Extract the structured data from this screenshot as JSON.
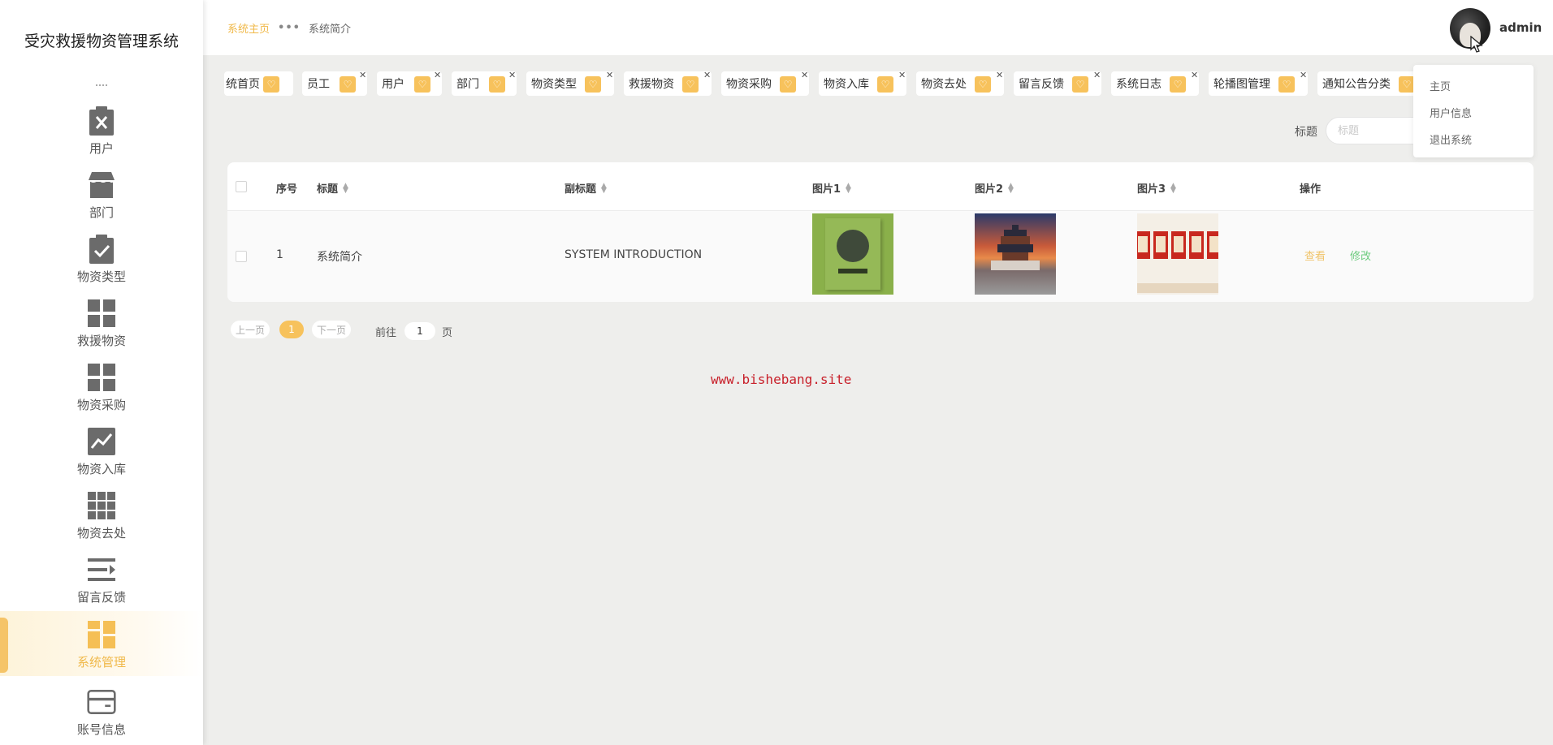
{
  "app": {
    "title": "受灾救援物资管理系统"
  },
  "sidebar": {
    "items": [
      {
        "label": "用户",
        "icon": "clipboard-x-icon",
        "active": false
      },
      {
        "label": "部门",
        "icon": "store-icon",
        "active": false
      },
      {
        "label": "物资类型",
        "icon": "clipboard-check-icon",
        "active": false
      },
      {
        "label": "救援物资",
        "icon": "grid-icon",
        "active": false
      },
      {
        "label": "物资采购",
        "icon": "grid-icon",
        "active": false
      },
      {
        "label": "物资入库",
        "icon": "chart-line-icon",
        "active": false
      },
      {
        "label": "物资去处",
        "icon": "apps-icon",
        "active": false
      },
      {
        "label": "留言反馈",
        "icon": "list-icon",
        "active": false
      },
      {
        "label": "系统管理",
        "icon": "dashboard-icon",
        "active": true
      },
      {
        "label": "账号信息",
        "icon": "card-icon",
        "active": false
      }
    ]
  },
  "header": {
    "breadcrumb_home": "系统主页",
    "breadcrumb_sep": "•••",
    "breadcrumb_current": "系统简介",
    "username": "admin"
  },
  "tabs": [
    {
      "label": "统首页"
    },
    {
      "label": "员工"
    },
    {
      "label": "用户"
    },
    {
      "label": "部门"
    },
    {
      "label": "物资类型"
    },
    {
      "label": "救援物资"
    },
    {
      "label": "物资采购"
    },
    {
      "label": "物资入库"
    },
    {
      "label": "物资去处"
    },
    {
      "label": "留言反馈"
    },
    {
      "label": "系统日志"
    },
    {
      "label": "轮播图管理"
    },
    {
      "label": "通知公告分类"
    }
  ],
  "user_menu": {
    "items": [
      "主页",
      "用户信息",
      "退出系统"
    ]
  },
  "search": {
    "label": "标题",
    "placeholder": "标题",
    "value": ""
  },
  "table": {
    "columns": [
      "序号",
      "标题",
      "副标题",
      "图片1",
      "图片2",
      "图片3",
      "操作"
    ],
    "rows": [
      {
        "index": "1",
        "title": "系统简介",
        "subtitle": "SYSTEM INTRODUCTION",
        "actions": {
          "view": "查看",
          "edit": "修改"
        }
      }
    ]
  },
  "pagination": {
    "prev": "上一页",
    "current": "1",
    "next": "下一页",
    "goto_label": "前往",
    "goto_value": "1",
    "page_unit": "页"
  },
  "watermark": "www.bishebang.site",
  "colors": {
    "accent": "#f7c25c",
    "accent_text": "#f0b94a",
    "edit": "#6ccb7e",
    "watermark": "#c8202a"
  }
}
